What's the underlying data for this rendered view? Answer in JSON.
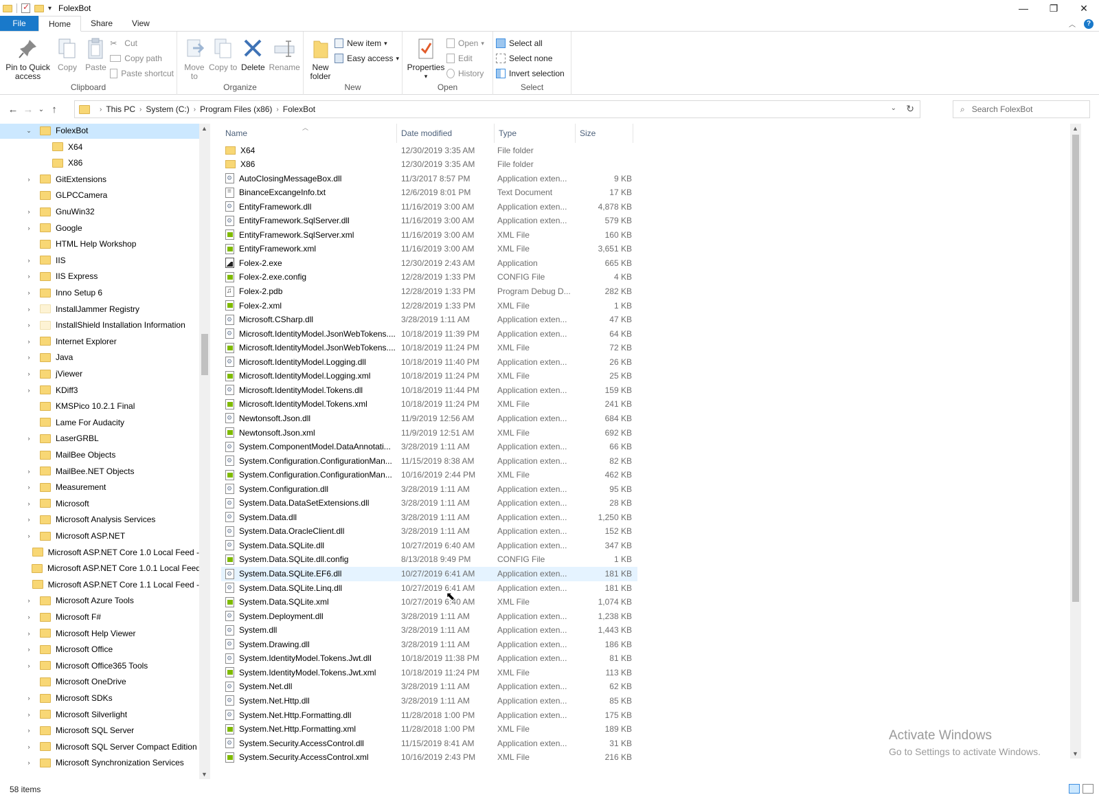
{
  "window": {
    "title": "FolexBot"
  },
  "tabs": {
    "file": "File",
    "home": "Home",
    "share": "Share",
    "view": "View"
  },
  "ribbon": {
    "clipboard": {
      "label": "Clipboard",
      "pin": "Pin to Quick access",
      "copy": "Copy",
      "paste": "Paste",
      "cut": "Cut",
      "copy_path": "Copy path",
      "paste_shortcut": "Paste shortcut"
    },
    "organize": {
      "label": "Organize",
      "move_to": "Move to",
      "copy_to": "Copy to",
      "delete": "Delete",
      "rename": "Rename"
    },
    "new": {
      "label": "New",
      "new_folder": "New folder",
      "new_item": "New item",
      "easy_access": "Easy access"
    },
    "open": {
      "label": "Open",
      "properties": "Properties",
      "open": "Open",
      "edit": "Edit",
      "history": "History"
    },
    "select": {
      "label": "Select",
      "select_all": "Select all",
      "select_none": "Select none",
      "invert_selection": "Invert selection"
    }
  },
  "address": {
    "crumbs": [
      "This PC",
      "System (C:)",
      "Program Files (x86)",
      "FolexBot"
    ],
    "search_placeholder": "Search FolexBot"
  },
  "columns": {
    "name": "Name",
    "date": "Date modified",
    "type": "Type",
    "size": "Size"
  },
  "nav_tree": [
    {
      "label": "FolexBot",
      "expander": "open",
      "level": 0,
      "selected": true
    },
    {
      "label": "X64",
      "expander": "none",
      "level": 1
    },
    {
      "label": "X86",
      "expander": "none",
      "level": 1
    },
    {
      "label": "GitExtensions",
      "expander": "closed",
      "level": 0
    },
    {
      "label": "GLPCCamera",
      "expander": "none",
      "level": 0
    },
    {
      "label": "GnuWin32",
      "expander": "closed",
      "level": 0
    },
    {
      "label": "Google",
      "expander": "closed",
      "level": 0
    },
    {
      "label": "HTML Help Workshop",
      "expander": "none",
      "level": 0
    },
    {
      "label": "IIS",
      "expander": "closed",
      "level": 0
    },
    {
      "label": "IIS Express",
      "expander": "closed",
      "level": 0
    },
    {
      "label": "Inno Setup 6",
      "expander": "closed",
      "level": 0
    },
    {
      "label": "InstallJammer Registry",
      "expander": "closed",
      "level": 0,
      "pale": true
    },
    {
      "label": "InstallShield Installation Information",
      "expander": "closed",
      "level": 0,
      "pale": true
    },
    {
      "label": "Internet Explorer",
      "expander": "closed",
      "level": 0
    },
    {
      "label": "Java",
      "expander": "closed",
      "level": 0
    },
    {
      "label": "jViewer",
      "expander": "closed",
      "level": 0
    },
    {
      "label": "KDiff3",
      "expander": "closed",
      "level": 0
    },
    {
      "label": "KMSPico 10.2.1 Final",
      "expander": "none",
      "level": 0
    },
    {
      "label": "Lame For Audacity",
      "expander": "none",
      "level": 0
    },
    {
      "label": "LaserGRBL",
      "expander": "closed",
      "level": 0
    },
    {
      "label": "MailBee Objects",
      "expander": "none",
      "level": 0
    },
    {
      "label": "MailBee.NET Objects",
      "expander": "closed",
      "level": 0
    },
    {
      "label": "Measurement",
      "expander": "closed",
      "level": 0
    },
    {
      "label": "Microsoft",
      "expander": "closed",
      "level": 0
    },
    {
      "label": "Microsoft Analysis Services",
      "expander": "closed",
      "level": 0
    },
    {
      "label": "Microsoft ASP.NET",
      "expander": "closed",
      "level": 0
    },
    {
      "label": "Microsoft ASP.NET Core 1.0 Local Feed -",
      "expander": "none",
      "level": 0
    },
    {
      "label": "Microsoft ASP.NET Core 1.0.1 Local Feed",
      "expander": "none",
      "level": 0
    },
    {
      "label": "Microsoft ASP.NET Core 1.1 Local Feed -",
      "expander": "none",
      "level": 0
    },
    {
      "label": "Microsoft Azure Tools",
      "expander": "closed",
      "level": 0
    },
    {
      "label": "Microsoft F#",
      "expander": "closed",
      "level": 0
    },
    {
      "label": "Microsoft Help Viewer",
      "expander": "closed",
      "level": 0
    },
    {
      "label": "Microsoft Office",
      "expander": "closed",
      "level": 0
    },
    {
      "label": "Microsoft Office365 Tools",
      "expander": "closed",
      "level": 0
    },
    {
      "label": "Microsoft OneDrive",
      "expander": "none",
      "level": 0
    },
    {
      "label": "Microsoft SDKs",
      "expander": "closed",
      "level": 0
    },
    {
      "label": "Microsoft Silverlight",
      "expander": "closed",
      "level": 0
    },
    {
      "label": "Microsoft SQL Server",
      "expander": "closed",
      "level": 0
    },
    {
      "label": "Microsoft SQL Server Compact Edition",
      "expander": "closed",
      "level": 0
    },
    {
      "label": "Microsoft Synchronization Services",
      "expander": "closed",
      "level": 0
    }
  ],
  "files": [
    {
      "name": "X64",
      "date": "12/30/2019 3:35 AM",
      "type": "File folder",
      "size": "",
      "icon": "folder"
    },
    {
      "name": "X86",
      "date": "12/30/2019 3:35 AM",
      "type": "File folder",
      "size": "",
      "icon": "folder"
    },
    {
      "name": "AutoClosingMessageBox.dll",
      "date": "11/3/2017 8:57 PM",
      "type": "Application exten...",
      "size": "9 KB",
      "icon": "dll"
    },
    {
      "name": "BinanceExcangeInfo.txt",
      "date": "12/6/2019 8:01 PM",
      "type": "Text Document",
      "size": "17 KB",
      "icon": "txt"
    },
    {
      "name": "EntityFramework.dll",
      "date": "11/16/2019 3:00 AM",
      "type": "Application exten...",
      "size": "4,878 KB",
      "icon": "dll"
    },
    {
      "name": "EntityFramework.SqlServer.dll",
      "date": "11/16/2019 3:00 AM",
      "type": "Application exten...",
      "size": "579 KB",
      "icon": "dll"
    },
    {
      "name": "EntityFramework.SqlServer.xml",
      "date": "11/16/2019 3:00 AM",
      "type": "XML File",
      "size": "160 KB",
      "icon": "xml"
    },
    {
      "name": "EntityFramework.xml",
      "date": "11/16/2019 3:00 AM",
      "type": "XML File",
      "size": "3,651 KB",
      "icon": "xml"
    },
    {
      "name": "Folex-2.exe",
      "date": "12/30/2019 2:43 AM",
      "type": "Application",
      "size": "665 KB",
      "icon": "exe"
    },
    {
      "name": "Folex-2.exe.config",
      "date": "12/28/2019 1:33 PM",
      "type": "CONFIG File",
      "size": "4 KB",
      "icon": "xml"
    },
    {
      "name": "Folex-2.pdb",
      "date": "12/28/2019 1:33 PM",
      "type": "Program Debug D...",
      "size": "282 KB",
      "icon": "pdb"
    },
    {
      "name": "Folex-2.xml",
      "date": "12/28/2019 1:33 PM",
      "type": "XML File",
      "size": "1 KB",
      "icon": "xml"
    },
    {
      "name": "Microsoft.CSharp.dll",
      "date": "3/28/2019 1:11 AM",
      "type": "Application exten...",
      "size": "47 KB",
      "icon": "dll"
    },
    {
      "name": "Microsoft.IdentityModel.JsonWebTokens....",
      "date": "10/18/2019 11:39 PM",
      "type": "Application exten...",
      "size": "64 KB",
      "icon": "dll"
    },
    {
      "name": "Microsoft.IdentityModel.JsonWebTokens....",
      "date": "10/18/2019 11:24 PM",
      "type": "XML File",
      "size": "72 KB",
      "icon": "xml"
    },
    {
      "name": "Microsoft.IdentityModel.Logging.dll",
      "date": "10/18/2019 11:40 PM",
      "type": "Application exten...",
      "size": "26 KB",
      "icon": "dll"
    },
    {
      "name": "Microsoft.IdentityModel.Logging.xml",
      "date": "10/18/2019 11:24 PM",
      "type": "XML File",
      "size": "25 KB",
      "icon": "xml"
    },
    {
      "name": "Microsoft.IdentityModel.Tokens.dll",
      "date": "10/18/2019 11:44 PM",
      "type": "Application exten...",
      "size": "159 KB",
      "icon": "dll"
    },
    {
      "name": "Microsoft.IdentityModel.Tokens.xml",
      "date": "10/18/2019 11:24 PM",
      "type": "XML File",
      "size": "241 KB",
      "icon": "xml"
    },
    {
      "name": "Newtonsoft.Json.dll",
      "date": "11/9/2019 12:56 AM",
      "type": "Application exten...",
      "size": "684 KB",
      "icon": "dll"
    },
    {
      "name": "Newtonsoft.Json.xml",
      "date": "11/9/2019 12:51 AM",
      "type": "XML File",
      "size": "692 KB",
      "icon": "xml"
    },
    {
      "name": "System.ComponentModel.DataAnnotati...",
      "date": "3/28/2019 1:11 AM",
      "type": "Application exten...",
      "size": "66 KB",
      "icon": "dll"
    },
    {
      "name": "System.Configuration.ConfigurationMan...",
      "date": "11/15/2019 8:38 AM",
      "type": "Application exten...",
      "size": "82 KB",
      "icon": "dll"
    },
    {
      "name": "System.Configuration.ConfigurationMan...",
      "date": "10/16/2019 2:44 PM",
      "type": "XML File",
      "size": "462 KB",
      "icon": "xml"
    },
    {
      "name": "System.Configuration.dll",
      "date": "3/28/2019 1:11 AM",
      "type": "Application exten...",
      "size": "95 KB",
      "icon": "dll"
    },
    {
      "name": "System.Data.DataSetExtensions.dll",
      "date": "3/28/2019 1:11 AM",
      "type": "Application exten...",
      "size": "28 KB",
      "icon": "dll"
    },
    {
      "name": "System.Data.dll",
      "date": "3/28/2019 1:11 AM",
      "type": "Application exten...",
      "size": "1,250 KB",
      "icon": "dll"
    },
    {
      "name": "System.Data.OracleClient.dll",
      "date": "3/28/2019 1:11 AM",
      "type": "Application exten...",
      "size": "152 KB",
      "icon": "dll"
    },
    {
      "name": "System.Data.SQLite.dll",
      "date": "10/27/2019 6:40 AM",
      "type": "Application exten...",
      "size": "347 KB",
      "icon": "dll"
    },
    {
      "name": "System.Data.SQLite.dll.config",
      "date": "8/13/2018 9:49 PM",
      "type": "CONFIG File",
      "size": "1 KB",
      "icon": "xml"
    },
    {
      "name": "System.Data.SQLite.EF6.dll",
      "date": "10/27/2019 6:41 AM",
      "type": "Application exten...",
      "size": "181 KB",
      "icon": "dll",
      "hover": true
    },
    {
      "name": "System.Data.SQLite.Linq.dll",
      "date": "10/27/2019 6:41 AM",
      "type": "Application exten...",
      "size": "181 KB",
      "icon": "dll"
    },
    {
      "name": "System.Data.SQLite.xml",
      "date": "10/27/2019 6:40 AM",
      "type": "XML File",
      "size": "1,074 KB",
      "icon": "xml"
    },
    {
      "name": "System.Deployment.dll",
      "date": "3/28/2019 1:11 AM",
      "type": "Application exten...",
      "size": "1,238 KB",
      "icon": "dll"
    },
    {
      "name": "System.dll",
      "date": "3/28/2019 1:11 AM",
      "type": "Application exten...",
      "size": "1,443 KB",
      "icon": "dll"
    },
    {
      "name": "System.Drawing.dll",
      "date": "3/28/2019 1:11 AM",
      "type": "Application exten...",
      "size": "186 KB",
      "icon": "dll"
    },
    {
      "name": "System.IdentityModel.Tokens.Jwt.dll",
      "date": "10/18/2019 11:38 PM",
      "type": "Application exten...",
      "size": "81 KB",
      "icon": "dll"
    },
    {
      "name": "System.IdentityModel.Tokens.Jwt.xml",
      "date": "10/18/2019 11:24 PM",
      "type": "XML File",
      "size": "113 KB",
      "icon": "xml"
    },
    {
      "name": "System.Net.dll",
      "date": "3/28/2019 1:11 AM",
      "type": "Application exten...",
      "size": "62 KB",
      "icon": "dll"
    },
    {
      "name": "System.Net.Http.dll",
      "date": "3/28/2019 1:11 AM",
      "type": "Application exten...",
      "size": "85 KB",
      "icon": "dll"
    },
    {
      "name": "System.Net.Http.Formatting.dll",
      "date": "11/28/2018 1:00 PM",
      "type": "Application exten...",
      "size": "175 KB",
      "icon": "dll"
    },
    {
      "name": "System.Net.Http.Formatting.xml",
      "date": "11/28/2018 1:00 PM",
      "type": "XML File",
      "size": "189 KB",
      "icon": "xml"
    },
    {
      "name": "System.Security.AccessControl.dll",
      "date": "11/15/2019 8:41 AM",
      "type": "Application exten...",
      "size": "31 KB",
      "icon": "dll"
    },
    {
      "name": "System.Security.AccessControl.xml",
      "date": "10/16/2019 2:43 PM",
      "type": "XML File",
      "size": "216 KB",
      "icon": "xml"
    }
  ],
  "watermark": {
    "line1": "Activate Windows",
    "line2": "Go to Settings to activate Windows."
  },
  "status": {
    "items": "58 items"
  }
}
